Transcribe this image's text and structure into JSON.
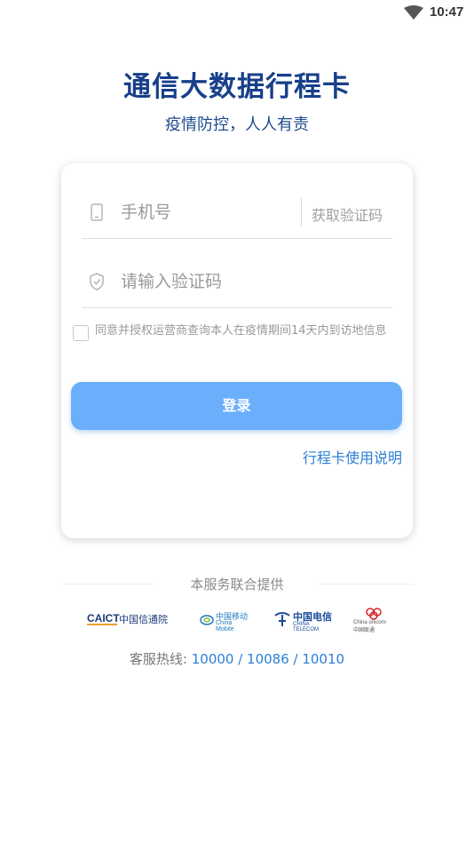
{
  "status_bar": {
    "time": "10:47",
    "wifi_icon": "wifi-icon"
  },
  "header": {
    "title": "通信大数据行程卡",
    "subtitle": "疫情防控，人人有责"
  },
  "form": {
    "phone": {
      "placeholder": "手机号",
      "value": "",
      "icon": "phone-icon"
    },
    "get_code_label": "获取验证码",
    "code": {
      "placeholder": "请输入验证码",
      "value": "",
      "icon": "shield-icon"
    },
    "agreement": {
      "checked": false,
      "text": "同意并授权运营商查询本人在疫情期间14天内到访地信息"
    },
    "login_label": "登录",
    "help_link": "行程卡使用说明"
  },
  "footer": {
    "providers_label": "本服务联合提供",
    "logos": {
      "caict": {
        "en": "CAICT",
        "zh": "中国信通院"
      },
      "cmcc": {
        "zh": "中国移动",
        "en": "China Mobile"
      },
      "ctel": {
        "zh": "中国电信",
        "en": "CHINA TELECOM"
      },
      "cuni": {
        "en": "China unicom中国联通"
      }
    },
    "hotline_label": "客服热线: ",
    "hotline_numbers": "10000 / 10086 / 10010"
  },
  "colors": {
    "title": "#173f8a",
    "accent_button": "#6aaefc",
    "link": "#2c7fd6"
  }
}
